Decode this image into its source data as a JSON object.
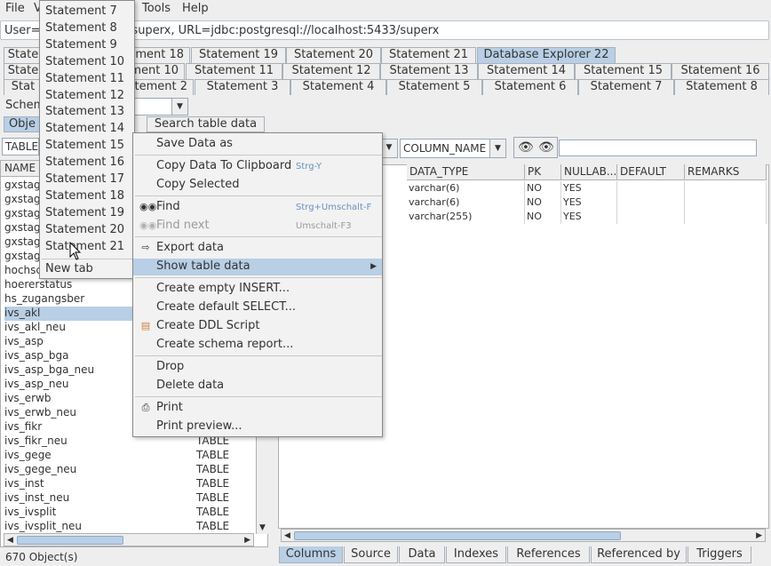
{
  "menubar": {
    "file": "File",
    "view": "V",
    "tools": "Tools",
    "help": "Help"
  },
  "connection": {
    "text": "User=superx, URL=jdbc:postgresql://localhost:5433/superx",
    "prefix": "User="
  },
  "tabs": {
    "row1": [
      "State",
      "Statement 18",
      "Statement 19",
      "Statement 20",
      "Statement 21",
      "Database Explorer 22"
    ],
    "row2": [
      "State",
      "Statement 10",
      "Statement 11",
      "Statement 12",
      "Statement 13",
      "Statement 14",
      "Statement 15",
      "Statement 16"
    ],
    "row3": [
      "Stat",
      "Statement 2",
      "Statement 3",
      "Statement 4",
      "Statement 5",
      "Statement 6",
      "Statement 7",
      "Statement 8"
    ]
  },
  "schema": {
    "label": "Schem"
  },
  "subtabs": {
    "objects": "Obje",
    "search": "Search table data"
  },
  "type_combo": {
    "value": "TABLE"
  },
  "column_combo": {
    "value": "COLUMN_NAME"
  },
  "left_table": {
    "header_name": "NAME",
    "rows": [
      {
        "name": "gxstag",
        "type": ""
      },
      {
        "name": "gxstag",
        "type": ""
      },
      {
        "name": "gxstag",
        "type": ""
      },
      {
        "name": "gxstag",
        "type": ""
      },
      {
        "name": "gxstag",
        "type": ""
      },
      {
        "name": "gxstag",
        "type": ""
      },
      {
        "name": "hochsc",
        "type": ""
      },
      {
        "name": "hoererstatus",
        "type": ""
      },
      {
        "name": "hs_zugangsber",
        "type": ""
      },
      {
        "name": "ivs_akl",
        "type": ""
      },
      {
        "name": "ivs_akl_neu",
        "type": ""
      },
      {
        "name": "ivs_asp",
        "type": ""
      },
      {
        "name": "ivs_asp_bga",
        "type": ""
      },
      {
        "name": "ivs_asp_bga_neu",
        "type": ""
      },
      {
        "name": "ivs_asp_neu",
        "type": ""
      },
      {
        "name": "ivs_erwb",
        "type": ""
      },
      {
        "name": "ivs_erwb_neu",
        "type": ""
      },
      {
        "name": "ivs_fikr",
        "type": ""
      },
      {
        "name": "ivs_fikr_neu",
        "type": "TABLE"
      },
      {
        "name": "ivs_gege",
        "type": "TABLE"
      },
      {
        "name": "ivs_gege_neu",
        "type": "TABLE"
      },
      {
        "name": "ivs_inst",
        "type": "TABLE"
      },
      {
        "name": "ivs_inst_neu",
        "type": "TABLE"
      },
      {
        "name": "ivs_ivsplit",
        "type": "TABLE"
      },
      {
        "name": "ivs_ivsplit_neu",
        "type": "TABLE"
      }
    ]
  },
  "status": {
    "text": "670 Object(s)"
  },
  "columns_grid": {
    "headers": [
      "DATA_TYPE",
      "PK",
      "NULLAB...",
      "DEFAULT",
      "REMARKS"
    ],
    "rows": [
      [
        "varchar(6)",
        "NO",
        "YES",
        "",
        ""
      ],
      [
        "varchar(6)",
        "NO",
        "YES",
        "",
        ""
      ],
      [
        "varchar(255)",
        "NO",
        "YES",
        "",
        ""
      ]
    ]
  },
  "bottom_tabs": [
    "Columns",
    "Source",
    "Data",
    "Indexes",
    "References",
    "Referenced by",
    "Triggers"
  ],
  "statement_menu": {
    "items": [
      "Statement 7",
      "Statement 8",
      "Statement 9",
      "Statement 10",
      "Statement 11",
      "Statement 12",
      "Statement 13",
      "Statement 14",
      "Statement 15",
      "Statement 16",
      "Statement 17",
      "Statement 18",
      "Statement 19",
      "Statement 20",
      "Statement 21"
    ],
    "new_tab": "New tab"
  },
  "context_menu": {
    "save_data_as": "Save Data as",
    "copy_clipboard": "Copy Data To Clipboard",
    "copy_clipboard_shortcut": "Strg-Y",
    "copy_selected": "Copy Selected",
    "find": "Find",
    "find_shortcut": "Strg+Umschalt-F",
    "find_next": "Find next",
    "find_next_shortcut": "Umschalt-F3",
    "export_data": "Export data",
    "show_table_data": "Show table data",
    "create_empty_insert": "Create empty INSERT...",
    "create_default_select": "Create default SELECT...",
    "create_ddl": "Create DDL Script",
    "create_schema_report": "Create schema report...",
    "drop": "Drop",
    "delete_data": "Delete data",
    "print": "Print",
    "print_preview": "Print preview..."
  },
  "colors": {
    "selection": "#b8cfe5",
    "border": "#a8b0bb"
  }
}
